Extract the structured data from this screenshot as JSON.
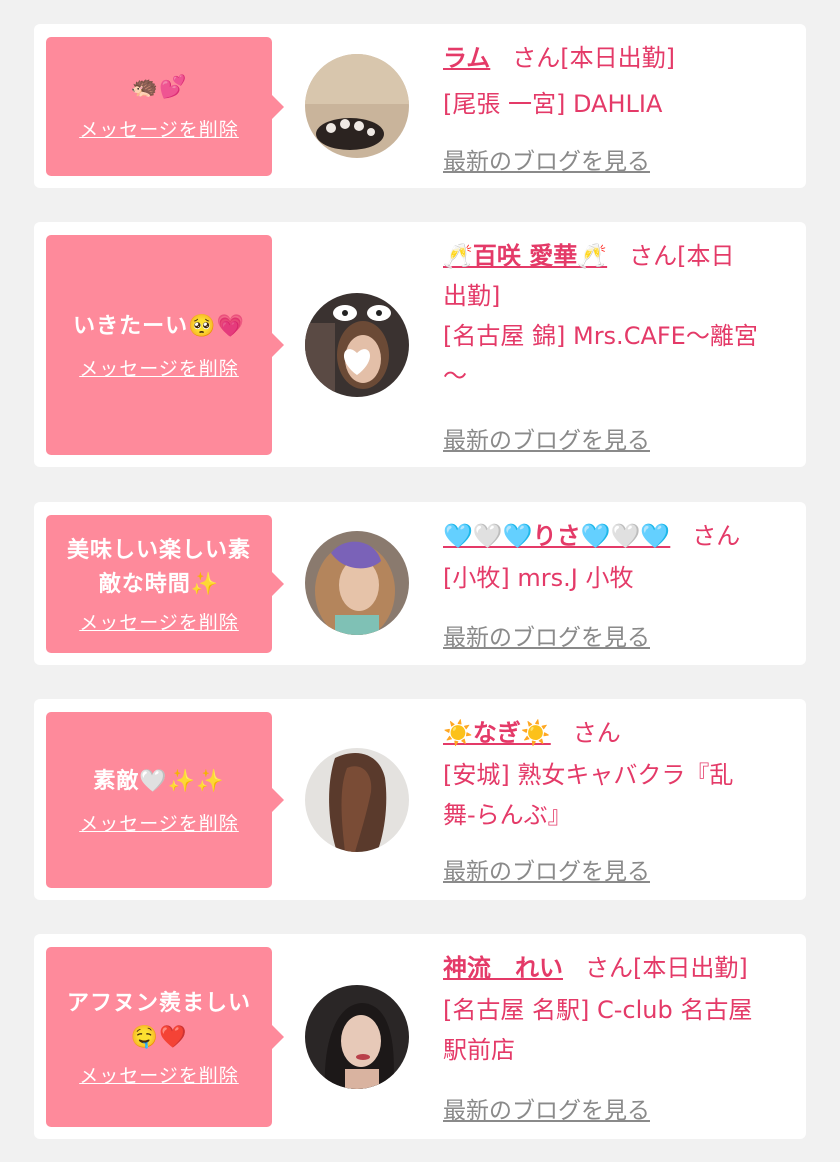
{
  "delete_label": "メッセージを削除",
  "blog_label": "最新のブログを見る",
  "san_label": "さん",
  "colors": {
    "bubble": "#fe8a9b",
    "accent": "#e43a68",
    "link_gray": "#8a8a8a",
    "background": "#f1f1f1"
  },
  "entries": [
    {
      "message_lines": [
        "🦔💕"
      ],
      "name": "ラム",
      "status": "[本日出勤]",
      "shop_lines": [
        "[尾張 一宮] DAHLIA"
      ]
    },
    {
      "message_lines": [
        "いきたーい🥺💗"
      ],
      "name": "🥂百咲 愛華🥂",
      "status": "[本日",
      "status2": "出勤]",
      "shop_lines": [
        "[名古屋 錦] Mrs.CAFE〜離宮",
        "〜"
      ]
    },
    {
      "message_lines": [
        "美味しい楽しい素",
        "敵な時間✨"
      ],
      "name": "🩵🤍🩵りさ🩵🤍🩵",
      "status": "",
      "shop_lines": [
        "[小牧] mrs.J 小牧"
      ]
    },
    {
      "message_lines": [
        "素敵🤍✨✨"
      ],
      "name": "☀️なぎ☀️",
      "status": "",
      "shop_lines": [
        "[安城] 熟女キャバクラ『乱",
        "舞-らんぶ』"
      ]
    },
    {
      "message_lines": [
        "アフヌン羨ましい",
        "🤤❤️"
      ],
      "name": "神流　れい",
      "status": "[本日出勤]",
      "shop_lines": [
        "[名古屋 名駅] C-club 名古屋",
        "駅前店"
      ]
    }
  ]
}
